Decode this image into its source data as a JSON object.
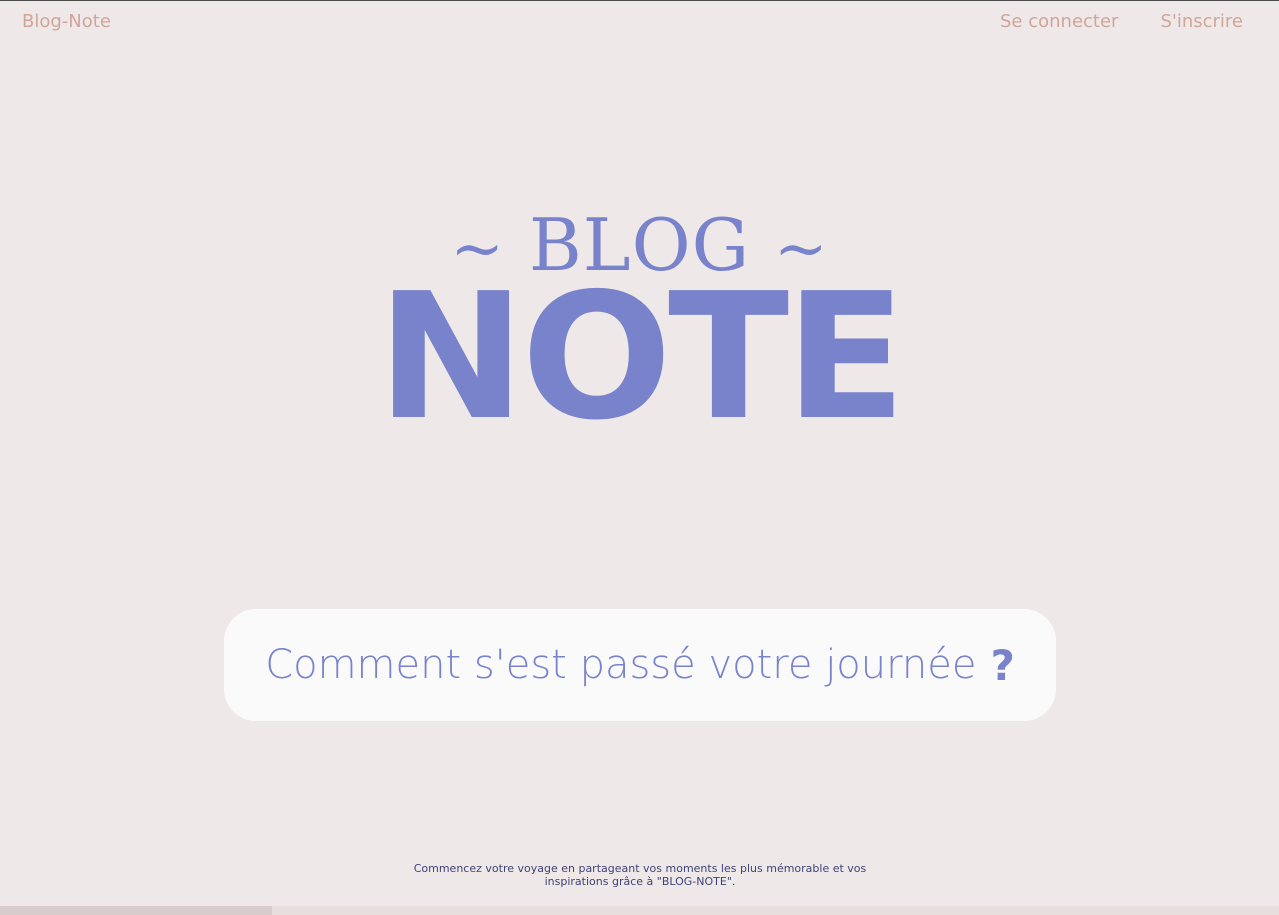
{
  "header": {
    "brand": "Blog-Note",
    "nav": {
      "login": "Se connecter",
      "signup": "S'inscrire"
    }
  },
  "logo": {
    "tilde_left": "~",
    "top_word": "BLOG",
    "tilde_right": "~",
    "main_word": "NOTE"
  },
  "prompt": {
    "text": "Comment s'est passé votre journée",
    "question_mark": "?"
  },
  "footer": {
    "text": "Commencez votre voyage en partageant vos moments les plus mémorable et vos inspirations grâce à \"BLOG-NOTE\"."
  },
  "colors": {
    "background": "#efe8e8",
    "accent": "#7883cc",
    "nav_text": "#d1a598",
    "footer_text": "#3f4375",
    "box": "#fbfafa"
  }
}
